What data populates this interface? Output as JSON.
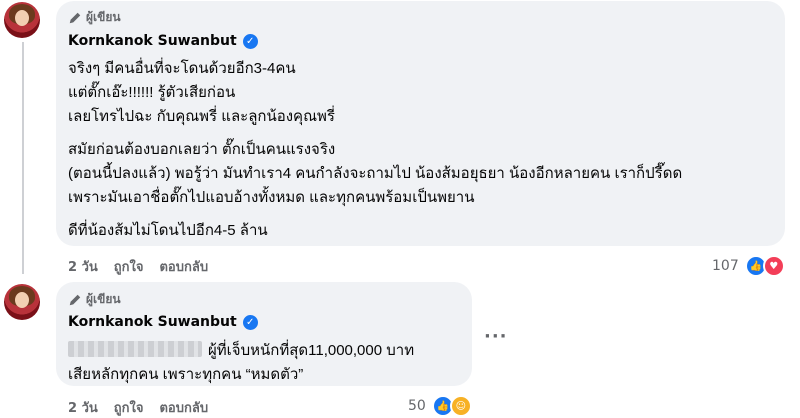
{
  "comment1": {
    "badge": "ผู้เขียน",
    "author": "Kornkanok Suwanbut",
    "lines": [
      "จริงๆ มีคนอื่นที่จะโดนด้วยอีก3-4คน",
      "แต่ตั๊กเอ๊ะ!!!!!! รู้ตัวเสียก่อน",
      "เลยโทรไปฉะ กับคุณพรี่ และลูกน้องคุณพรี่",
      "สมัยก่อนต้องบอกเลยว่า ตั๊กเป็นคนแรงจริง",
      "(ตอนนี้ปลงแล้ว) พอรู้ว่า มันทำเรา4 คนกำลังจะถามไป น้องส้มอยุธยา น้องอีกหลายคน เราก็ปรี๊ดด",
      "เพราะมันเอาชื่อตั๊กไปแอบอ้างทั้งหมด และทุกคนพร้อมเป็นพยาน",
      "ดีที่น้องส้มไม่โดนไปอีก4-5 ล้าน"
    ],
    "time": "2 วัน",
    "like": "ถูกใจ",
    "reply": "ตอบกลับ",
    "reaction_count": "107"
  },
  "comment2": {
    "badge": "ผู้เขียน",
    "author": "Kornkanok Suwanbut",
    "lines": [
      "ผู้ที่เจ็บหนักที่สุด11,000,000 บาท",
      "เสียหลักทุกคน เพราะทุกคน “หมดตัว”"
    ],
    "time": "2 วัน",
    "like": "ถูกใจ",
    "reply": "ตอบกลับ",
    "reaction_count": "50",
    "more": "···"
  },
  "icons": {
    "verified": "✓",
    "like": "👍",
    "love": "♥",
    "care": "☺"
  }
}
